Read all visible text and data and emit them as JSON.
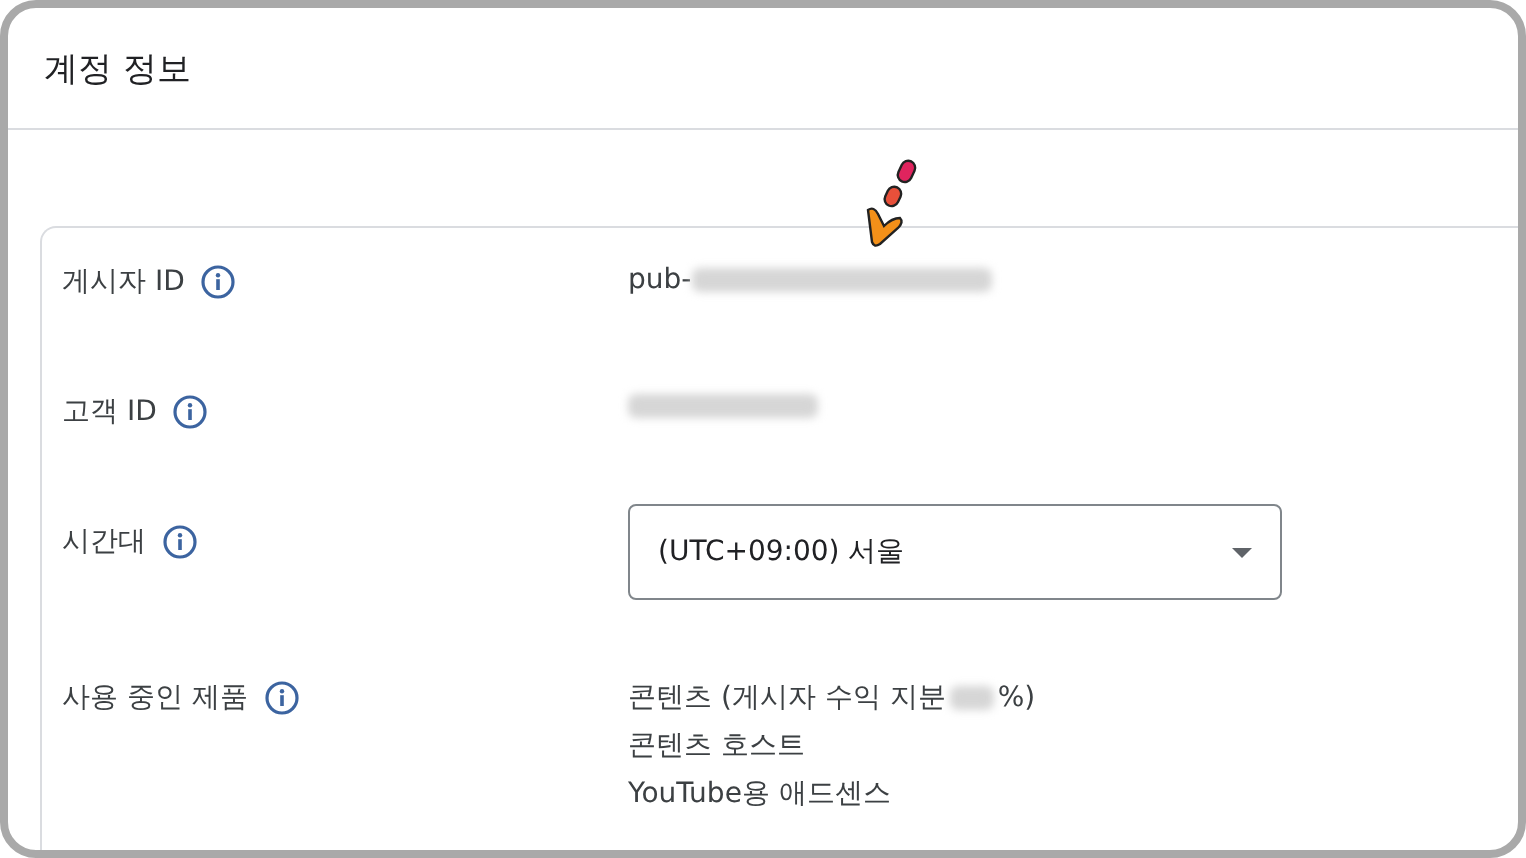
{
  "page": {
    "title": "계정 정보"
  },
  "fields": [
    {
      "kind": "text",
      "label": "게시자 ID",
      "value": "pub-",
      "redacted": true
    },
    {
      "kind": "text",
      "label": "고객 ID",
      "redacted": true
    },
    {
      "kind": "select",
      "label": "시간대",
      "value": "(UTC+09:00) 서울"
    },
    {
      "kind": "list",
      "label": "사용 중인 제품",
      "items": [
        {
          "text": "콘텐츠 (게시자 수익 지분 ",
          "redacted": true,
          "after": "%)"
        },
        {
          "text": "콘텐츠 호스트"
        },
        {
          "text": "YouTube용 애드센스"
        }
      ]
    }
  ]
}
